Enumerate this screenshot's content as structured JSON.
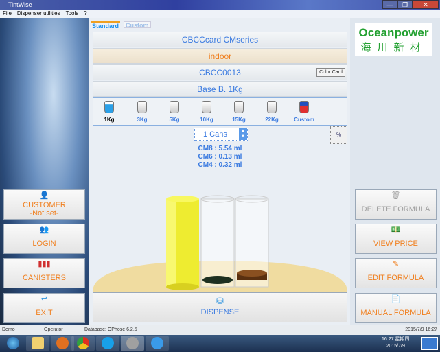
{
  "window": {
    "title": "TintWise",
    "minimize": "—",
    "maximize": "❐",
    "close": "✕"
  },
  "menu": [
    "File",
    "Dispenser utilities",
    "Tools",
    "?"
  ],
  "tabs": [
    {
      "label": "Standard",
      "active": true
    },
    {
      "label": "Custom",
      "active": false
    }
  ],
  "formula": {
    "card": "CBCCcard CMseries",
    "usage": "indoor",
    "code": "CBCC0013",
    "color_card_label": "Color Card",
    "base": "Base B. 1Kg"
  },
  "can_sizes": [
    {
      "label": "1Kg",
      "selected": true
    },
    {
      "label": "3Kg"
    },
    {
      "label": "5Kg"
    },
    {
      "label": "10Kg"
    },
    {
      "label": "15Kg"
    },
    {
      "label": "22Kg"
    },
    {
      "label": "Custom"
    }
  ],
  "cans_spinner": {
    "value": "1 Cans"
  },
  "calc_icon": "percent-calculator-icon",
  "colorants": [
    "CM8 : 5.54 ml",
    "CM6 : 0.13 ml",
    "CM4 : 0.32 ml"
  ],
  "colorant_colors": {
    "CM8": "#f0e020",
    "CM6": "#1e3020",
    "CM4": "#5a3010"
  },
  "left_buttons": {
    "customer": "CUSTOMER",
    "customer_sub": "-Not set-",
    "login": "LOGIN",
    "canisters": "CANISTERS",
    "exit": "EXIT"
  },
  "right_buttons": {
    "delete": "DELETE FORMULA",
    "view_price": "VIEW PRICE",
    "edit": "EDIT FORMULA",
    "manual": "MANUAL FORMULA"
  },
  "dispense": "DISPENSE",
  "logo": {
    "text": "Oceanpower",
    "sub": "海川新材"
  },
  "status": {
    "mode": "Demo",
    "user": "Operator",
    "database": "Database: OPhose 6.2.5",
    "datetime": "2015/7/9 16:27"
  },
  "taskbar": {
    "time": "16:27 星期四",
    "date": "2015/7/9"
  }
}
